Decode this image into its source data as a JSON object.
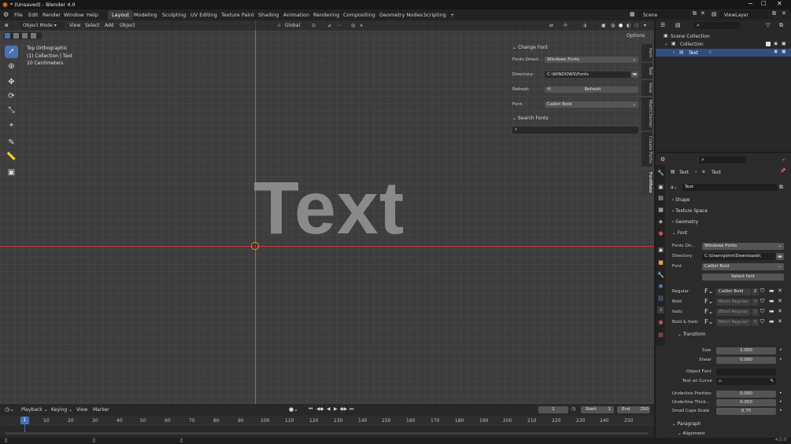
{
  "window": {
    "title": "* (Unsaved) - Blender 4.0"
  },
  "menu": {
    "items": [
      "File",
      "Edit",
      "Render",
      "Window",
      "Help"
    ],
    "workspaces": [
      "Layout",
      "Modeling",
      "Sculpting",
      "UV Editing",
      "Texture Paint",
      "Shading",
      "Animation",
      "Rendering",
      "Compositing",
      "Geometry Nodes",
      "Scripting"
    ],
    "active_workspace": "Layout",
    "add_tab": "+",
    "scene": "Scene",
    "view_layer": "ViewLayer"
  },
  "viewport": {
    "mode": "Object Mode",
    "menu": [
      "View",
      "Select",
      "Add",
      "Object"
    ],
    "transform_orientation": "Global",
    "options": "Options",
    "overlay_info": {
      "line1": "Top Orthographic",
      "line2": "(1) Collection | Text",
      "line3": "10 Centimeters"
    },
    "object_text": "Text",
    "side_tabs": [
      "Item",
      "Tool",
      "View",
      "MathChemer",
      "Create Paths",
      "FontMake"
    ]
  },
  "npanel": {
    "change_font_header": "Change Font",
    "fonts_dir_label": "Fonts Direct...",
    "fonts_dir_value": "Windows Fonts",
    "directory_label": "Directory:",
    "directory_value": "C:\\WINDOWS\\Fonts",
    "refresh_label": "Refresh",
    "refresh_button": "Refresh",
    "font_label": "Font:",
    "font_value": "Calibri Bold",
    "search_header": "Search Fonts"
  },
  "outliner": {
    "root": "Scene Collection",
    "collection": "Collection",
    "object": "Text"
  },
  "properties": {
    "breadcrumb": [
      "Text",
      "Text"
    ],
    "data_name": "Text",
    "sections": {
      "shape": "Shape",
      "texture_space": "Texture Space",
      "geometry": "Geometry",
      "font": "Font",
      "transform": "Transform",
      "paragraph": "Paragraph",
      "alignment": "Alignment"
    },
    "fonts_dir_label": "Fonts Dir...",
    "fonts_dir_value": "Windows Fonts",
    "directory_label": "Directory",
    "directory_value": "C:\\Users\\jshnl\\Downloads\\",
    "font_label": "Font",
    "font_value": "Calibri Bold",
    "select_font": "Select font",
    "font_slots": [
      {
        "label": "Regular",
        "value": "Calibri Bold",
        "users": "2"
      },
      {
        "label": "Bold",
        "value": "Bfont Regular",
        "users": "3"
      },
      {
        "label": "Italic",
        "value": "Bfont Regular",
        "users": "3"
      },
      {
        "label": "Bold & Italic",
        "value": "Bfont Regular",
        "users": "3"
      }
    ],
    "transform": {
      "size_label": "Size",
      "size_value": "1.000",
      "shear_label": "Shear",
      "shear_value": "0.000",
      "object_font_label": "Object Font",
      "text_on_curve_label": "Text on Curve",
      "underline_pos_label": "Underline Position",
      "underline_pos_value": "0.000",
      "underline_thick_label": "Underline Thick...",
      "underline_thick_value": "0.050",
      "small_caps_label": "Small Caps Scale",
      "small_caps_value": "0.75"
    }
  },
  "timeline": {
    "menu": [
      "Playback",
      "Keying",
      "View",
      "Marker"
    ],
    "current_frame": "1",
    "start_label": "Start",
    "start_value": "1",
    "end_label": "End",
    "end_value": "250",
    "ticks": [
      "1",
      "10",
      "20",
      "30",
      "40",
      "50",
      "60",
      "70",
      "80",
      "90",
      "100",
      "110",
      "120",
      "130",
      "140",
      "150",
      "160",
      "170",
      "180",
      "190",
      "200",
      "210",
      "220",
      "230",
      "240",
      "250"
    ]
  },
  "status": {
    "version": "4.0.0"
  },
  "colors": {
    "accent": "#4772b3",
    "x_axis": "#c0393b",
    "y_axis": "#6d8c1e",
    "text_object": "#8a8a8a"
  }
}
